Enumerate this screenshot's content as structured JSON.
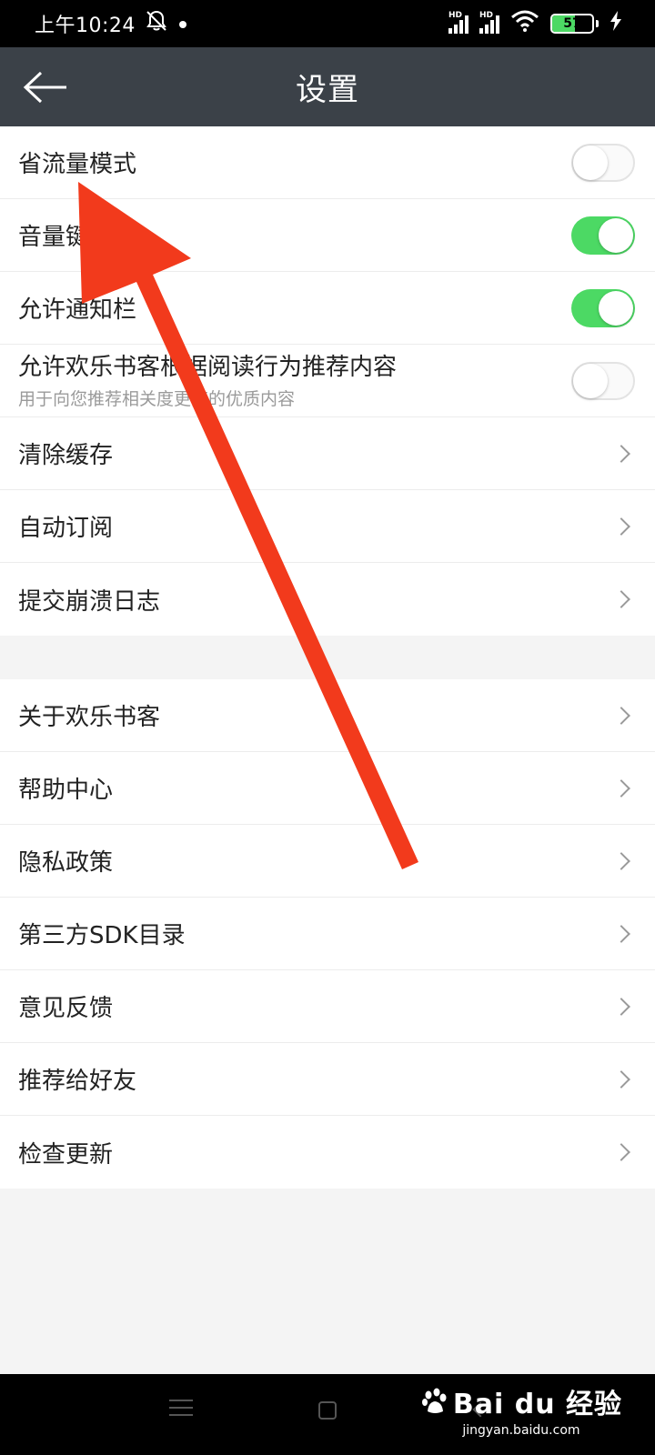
{
  "status_bar": {
    "time": "上午10:24",
    "signal1_label": "HD",
    "signal2_label": "HD",
    "battery_percent": "57",
    "battery_level": 0.57
  },
  "toolbar": {
    "title": "设置"
  },
  "settings": {
    "toggles": [
      {
        "label": "省流量模式",
        "on": false
      },
      {
        "label": "音量键翻页",
        "on": true
      },
      {
        "label": "允许通知栏",
        "on": true
      },
      {
        "label": "允许欢乐书客根据阅读行为推荐内容",
        "sublabel": "用于向您推荐相关度更高的优质内容",
        "on": false
      }
    ],
    "links_group1": [
      "清除缓存",
      "自动订阅",
      "提交崩溃日志"
    ],
    "links_group2": [
      "关于欢乐书客",
      "帮助中心",
      "隐私政策",
      "第三方SDK目录",
      "意见反馈",
      "推荐给好友",
      "检查更新"
    ]
  },
  "watermark": {
    "brand": "Bai du 经验",
    "url": "jingyan.baidu.com"
  },
  "colors": {
    "toolbar_bg": "#3b4148",
    "switch_on": "#4cd964",
    "annotation_arrow": "#f23a1c"
  }
}
